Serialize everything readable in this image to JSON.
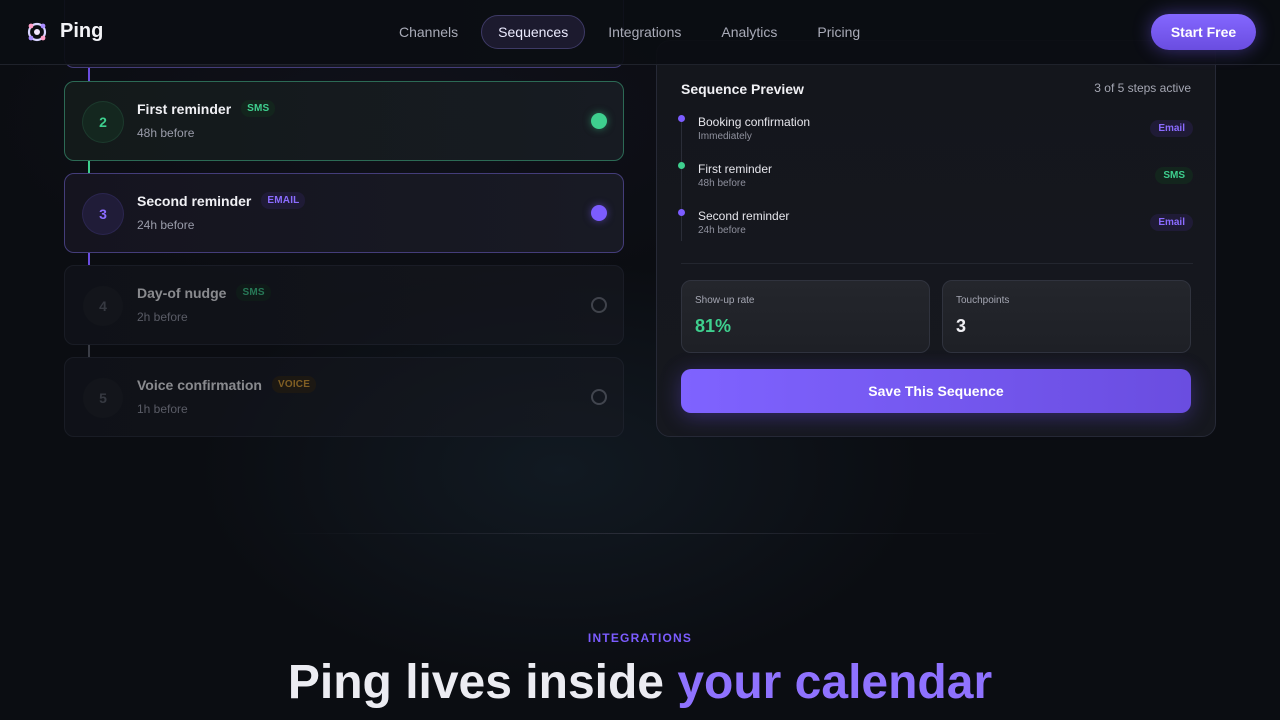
{
  "header": {
    "brand": "Ping",
    "nav": [
      "Channels",
      "Sequences",
      "Integrations",
      "Analytics",
      "Pricing"
    ],
    "active_nav": "Sequences",
    "cta": "Start Free"
  },
  "steps": [
    {
      "num": "2",
      "title": "First reminder",
      "channel": "SMS",
      "timing": "48h before",
      "state": "active"
    },
    {
      "num": "3",
      "title": "Second reminder",
      "channel": "EMAIL",
      "timing": "24h before",
      "state": "active"
    },
    {
      "num": "4",
      "title": "Day-of nudge",
      "channel": "SMS",
      "timing": "2h before",
      "state": "inactive"
    },
    {
      "num": "5",
      "title": "Voice confirmation",
      "channel": "VOICE",
      "timing": "1h before",
      "state": "inactive"
    }
  ],
  "preview": {
    "title": "Sequence Preview",
    "status": "3 of 5 steps active",
    "items": [
      {
        "name": "Booking confirmation",
        "when": "Immediately",
        "channel": "Email"
      },
      {
        "name": "First reminder",
        "when": "48h before",
        "channel": "SMS"
      },
      {
        "name": "Second reminder",
        "when": "24h before",
        "channel": "Email"
      }
    ],
    "metrics": [
      {
        "label": "Show-up rate",
        "value": "81%"
      },
      {
        "label": "Touchpoints",
        "value": "3"
      }
    ],
    "save_label": "Save This Sequence"
  },
  "integrations": {
    "eyebrow": "INTEGRATIONS",
    "headline_main": "Ping lives inside ",
    "headline_accent": "your calendar"
  },
  "colors": {
    "accent_purple": "#7c5cff",
    "accent_green": "#3ecf8e",
    "accent_orange": "#e0a030",
    "background": "#0b0d12"
  }
}
